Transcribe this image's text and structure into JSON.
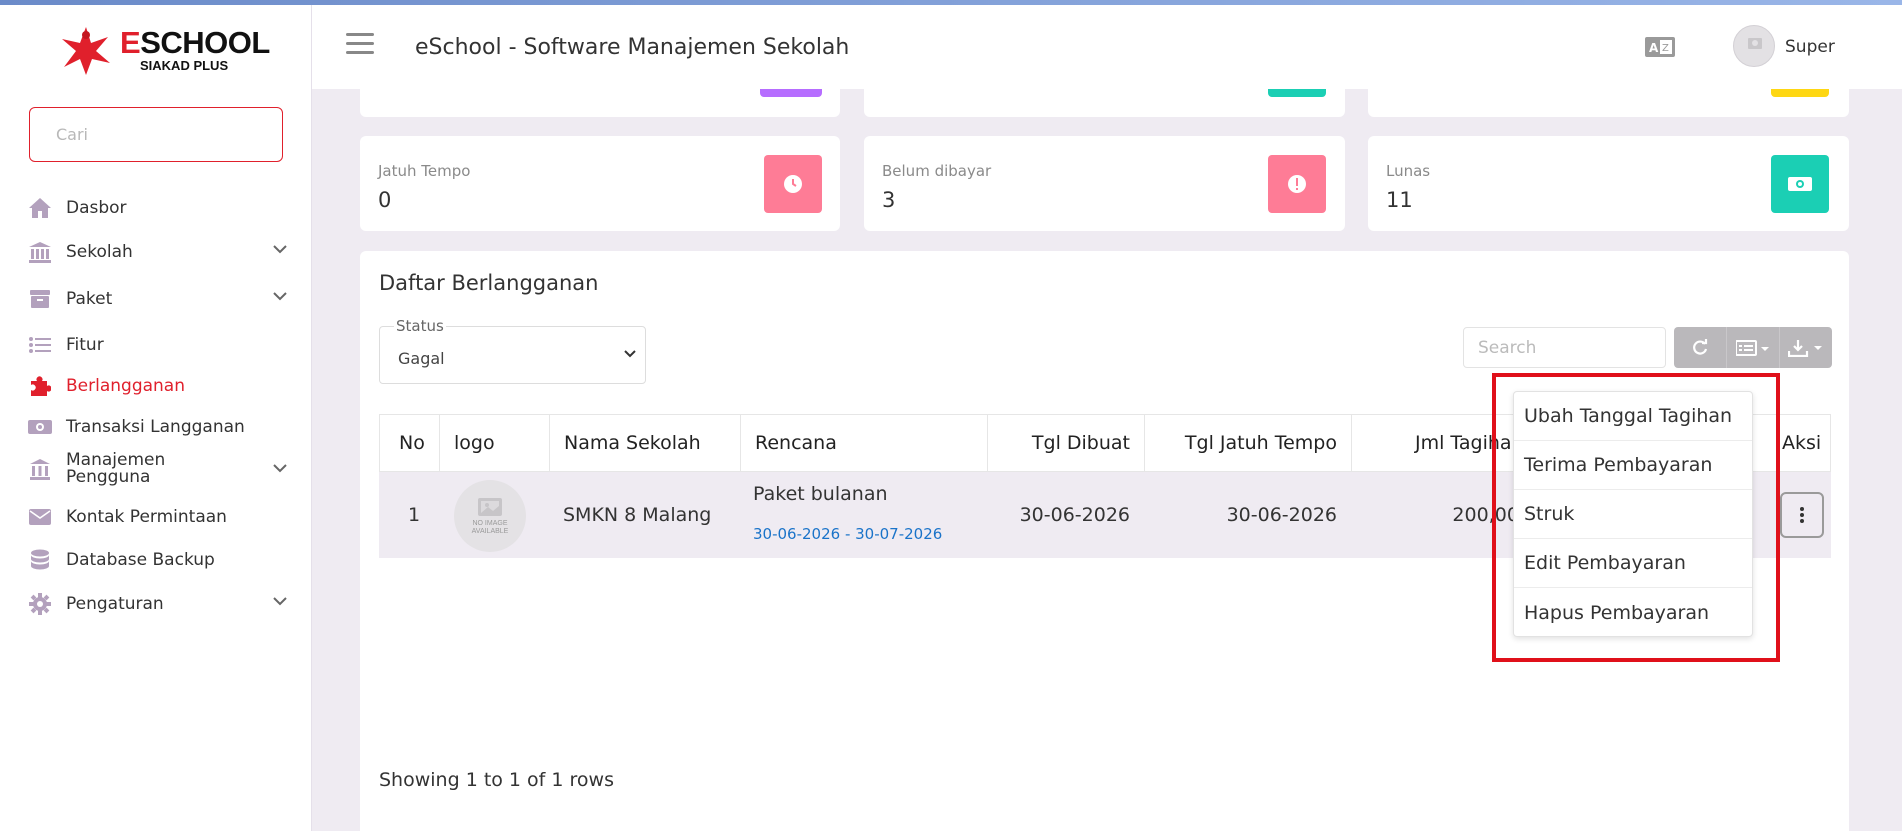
{
  "brand": {
    "logo_text_e": "E",
    "logo_text_rest": "SCHOOL",
    "logo_sub": "SIAKAD PLUS"
  },
  "header": {
    "title": "eSchool - Software Manajemen Sekolah",
    "user_name": "Super"
  },
  "sidebar": {
    "search_placeholder": "Cari",
    "items": [
      {
        "label": "Dasbor",
        "icon": "home-icon",
        "has_chevron": false,
        "active": false
      },
      {
        "label": "Sekolah",
        "icon": "bank-icon",
        "has_chevron": true,
        "active": false
      },
      {
        "label": "Paket",
        "icon": "archive-icon",
        "has_chevron": true,
        "active": false
      },
      {
        "label": "Fitur",
        "icon": "list-icon",
        "has_chevron": false,
        "active": false
      },
      {
        "label": "Berlangganan",
        "icon": "puzzle-icon",
        "has_chevron": false,
        "active": true
      },
      {
        "label": "Transaksi Langganan",
        "icon": "money-icon",
        "has_chevron": false,
        "active": false
      },
      {
        "label": "Manajemen\nPengguna",
        "icon": "user-bank-icon",
        "has_chevron": true,
        "active": false
      },
      {
        "label": "Kontak Permintaan",
        "icon": "envelope-icon",
        "has_chevron": false,
        "active": false
      },
      {
        "label": "Database Backup",
        "icon": "database-icon",
        "has_chevron": false,
        "active": false
      },
      {
        "label": "Pengaturan",
        "icon": "gear-icon",
        "has_chevron": true,
        "active": false
      }
    ]
  },
  "stats": [
    {
      "label": "Jatuh Tempo",
      "value": "0",
      "icon": "clock-icon",
      "color": "#fe7c96"
    },
    {
      "label": "Belum dibayar",
      "value": "3",
      "icon": "exclamation-icon",
      "color": "#fe7c96"
    },
    {
      "label": "Lunas",
      "value": "11",
      "icon": "money-icon",
      "color": "#1bcfb4"
    }
  ],
  "colors": {
    "accent": "#e0202c",
    "purple": "#b66dff",
    "teal": "#1bcfb4",
    "yellow": "#fed713",
    "pink": "#fe7c96",
    "link": "#1a73c9"
  },
  "panel": {
    "title": "Daftar Berlangganan",
    "status_label": "Status",
    "status_value": "Gagal",
    "search_placeholder": "Search",
    "columns": [
      "No",
      "logo",
      "Nama Sekolah",
      "Rencana",
      "Tgl Dibuat",
      "Tgl Jatuh Tempo",
      "Jml Tagihan(",
      "Aksi"
    ],
    "rows": [
      {
        "no": "1",
        "logo_text": "NO IMAGE AVAILABLE",
        "school": "SMKN 8 Malang",
        "plan": "Paket bulanan",
        "plan_dates": "30-06-2026 - 30-07-2026",
        "created": "30-06-2026",
        "due": "30-06-2026",
        "amount": "200,000"
      }
    ],
    "showing": "Showing 1 to 1 of 1 rows"
  },
  "dropdown": {
    "items": [
      "Ubah Tanggal Tagihan",
      "Terima Pembayaran",
      "Struk",
      "Edit Pembayaran",
      "Hapus Pembayaran"
    ]
  }
}
